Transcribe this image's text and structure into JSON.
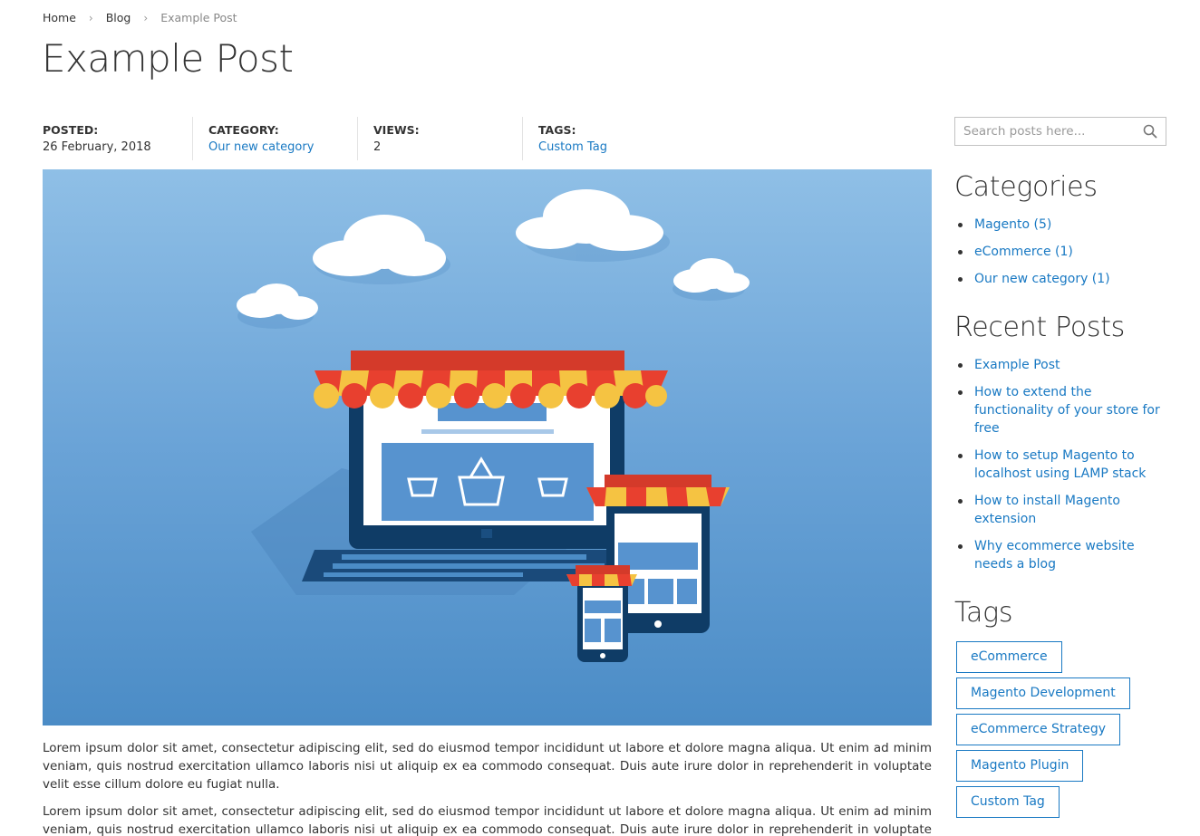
{
  "breadcrumb": {
    "home": "Home",
    "blog": "Blog",
    "current": "Example Post",
    "separator": "›"
  },
  "page_title": "Example Post",
  "meta": {
    "posted_label": "POSTED:",
    "posted_value": "26 February, 2018",
    "category_label": "CATEGORY:",
    "category_value": "Our new category",
    "views_label": "VIEWS:",
    "views_value": "2",
    "tags_label": "TAGS:",
    "tags_value": "Custom Tag"
  },
  "content": {
    "paragraph_1": "Lorem ipsum dolor sit amet, consectetur adipiscing elit, sed do eiusmod tempor incididunt ut labore et dolore magna aliqua. Ut enim ad minim veniam, quis nostrud exercitation ullamco laboris nisi ut aliquip ex ea commodo consequat. Duis aute irure dolor in reprehenderit in voluptate velit esse cillum dolore eu fugiat nulla.",
    "paragraph_2": "Lorem ipsum dolor sit amet, consectetur adipiscing elit, sed do eiusmod tempor incididunt ut labore et dolore magna aliqua. Ut enim ad minim veniam, quis nostrud exercitation ullamco laboris nisi ut aliquip ex ea commodo consequat. Duis aute irure dolor in reprehenderit in voluptate velit"
  },
  "sidebar": {
    "search_placeholder": "Search posts here...",
    "search_icon": "search-icon",
    "categories_title": "Categories",
    "categories": [
      "Magento (5)",
      "eCommerce (1)",
      "Our new category (1)"
    ],
    "recent_title": "Recent Posts",
    "recent_posts": [
      "Example Post",
      "How to extend the functionality of your store for free",
      "How to setup Magento to localhost using LAMP stack",
      "How to install Magento extension",
      "Why ecommerce website needs a blog"
    ],
    "tags_title": "Tags",
    "tags": [
      "eCommerce",
      "Magento Development",
      "eCommerce Strategy",
      "Magento Plugin",
      "Custom Tag"
    ]
  },
  "colors": {
    "link": "#1979c3",
    "text": "#333333",
    "awning_red": "#e8402f",
    "awning_yellow": "#f5c342"
  }
}
